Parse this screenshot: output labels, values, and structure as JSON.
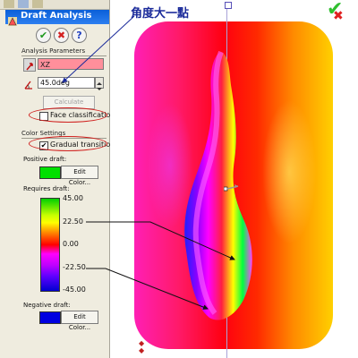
{
  "panel": {
    "title": "Draft Analysis",
    "buttons": {
      "ok": "✔",
      "cancel": "✖",
      "help": "?"
    },
    "analysis_section": "Analysis Parameters",
    "direction_value": "XZ",
    "angle_value": "45.0deg",
    "calculate_label": "Calculate",
    "face_classification_label": "Face classification",
    "face_classification_checked": false,
    "color_section": "Color Settings",
    "gradual_transition_label": "Gradual transition",
    "gradual_transition_checked": true,
    "positive_label": "Positive draft:",
    "positive_color": "#00e000",
    "requires_label": "Requires draft:",
    "negative_label": "Negative draft:",
    "negative_color": "#0000e0",
    "edit_color_label": "Edit Color...",
    "scale_ticks": [
      "45.00",
      "22.50",
      "0.00",
      "-22.50",
      "-45.00"
    ]
  },
  "annotation": {
    "text": "角度大一點"
  },
  "colors": {
    "accent": "#0a5fd8",
    "highlight": "#d0201e",
    "annotation": "#1a2a9a"
  },
  "icons": {
    "title": "draft-analysis-icon",
    "ok": "check-icon",
    "cancel": "close-icon",
    "help": "help-icon",
    "direction": "direction-arrow-icon",
    "angle": "angle-icon",
    "viewport_ok": "confirm-check-icon",
    "viewport_close": "close-x-icon"
  }
}
